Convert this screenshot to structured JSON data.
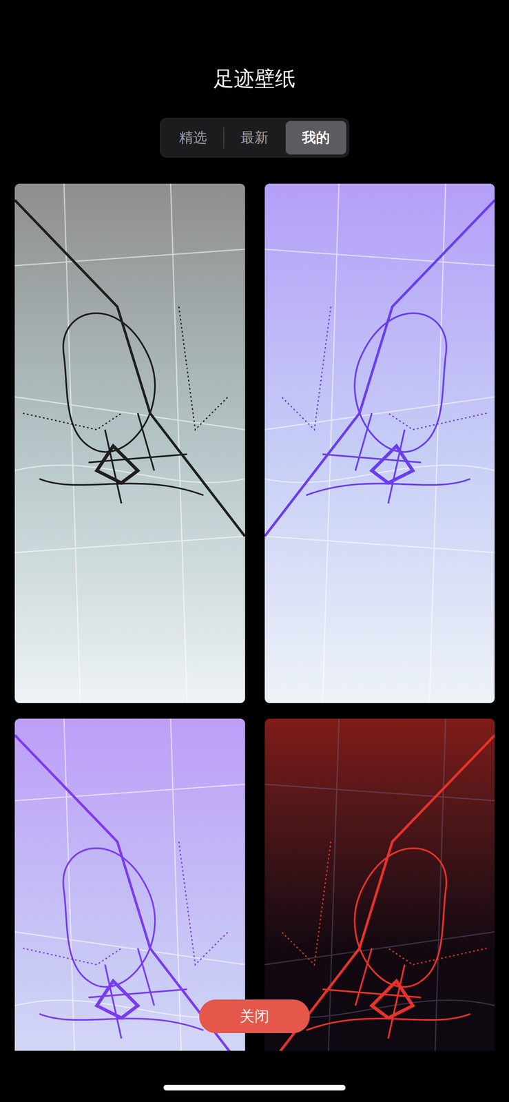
{
  "title": "足迹壁纸",
  "tabs": [
    {
      "label": "精选",
      "selected": false
    },
    {
      "label": "最新",
      "selected": false
    },
    {
      "label": "我的",
      "selected": true
    }
  ],
  "wallpapers": [
    {
      "kind": "light",
      "color": "#1e1e1e"
    },
    {
      "kind": "light",
      "color": "#6a3df2"
    },
    {
      "kind": "light",
      "color": "#7a3cf0"
    },
    {
      "kind": "dark",
      "color": "#e8322a"
    }
  ],
  "close_button": "关闭"
}
